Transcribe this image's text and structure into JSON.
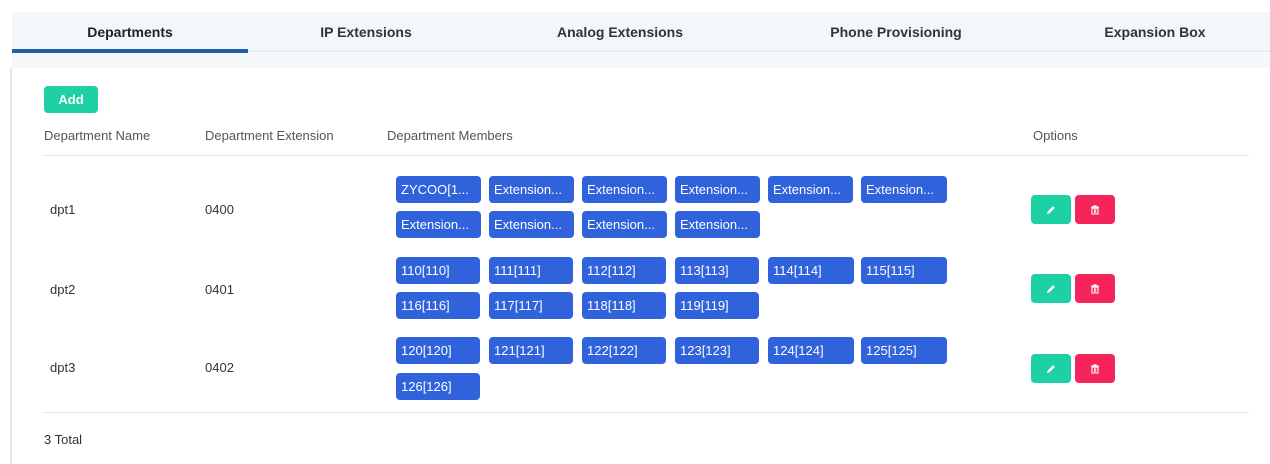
{
  "tabs": [
    {
      "label": "Departments",
      "active": true
    },
    {
      "label": "IP Extensions",
      "active": false
    },
    {
      "label": "Analog Extensions",
      "active": false
    },
    {
      "label": "Phone Provisioning",
      "active": false
    },
    {
      "label": "Expansion Box",
      "active": false
    }
  ],
  "toolbar": {
    "add_label": "Add"
  },
  "table": {
    "headers": [
      "Department Name",
      "Department Extension",
      "Department Members",
      "Options"
    ],
    "rows": [
      {
        "name": "dpt1",
        "extension": "0400",
        "members": [
          "ZYCOO[1...",
          "Extension...",
          "Extension...",
          "Extension...",
          "Extension...",
          "Extension...",
          "Extension...",
          "Extension...",
          "Extension...",
          "Extension..."
        ]
      },
      {
        "name": "dpt2",
        "extension": "0401",
        "members": [
          "110[110]",
          "111[111]",
          "112[112]",
          "113[113]",
          "114[114]",
          "115[115]",
          "116[116]",
          "117[117]",
          "118[118]",
          "119[119]"
        ]
      },
      {
        "name": "dpt3",
        "extension": "0402",
        "members": [
          "120[120]",
          "121[121]",
          "122[122]",
          "123[123]",
          "124[124]",
          "125[125]",
          "126[126]"
        ]
      }
    ],
    "options": {
      "edit_icon": "pencil-icon",
      "delete_icon": "trash-icon"
    }
  },
  "footer": {
    "total": "3 Total"
  },
  "colors": {
    "accent_tab": "#1f5ea8",
    "add_button": "#1ed1a4",
    "member_tag": "#2f62db",
    "edit_button": "#1ed1a4",
    "delete_button": "#f5245b"
  }
}
